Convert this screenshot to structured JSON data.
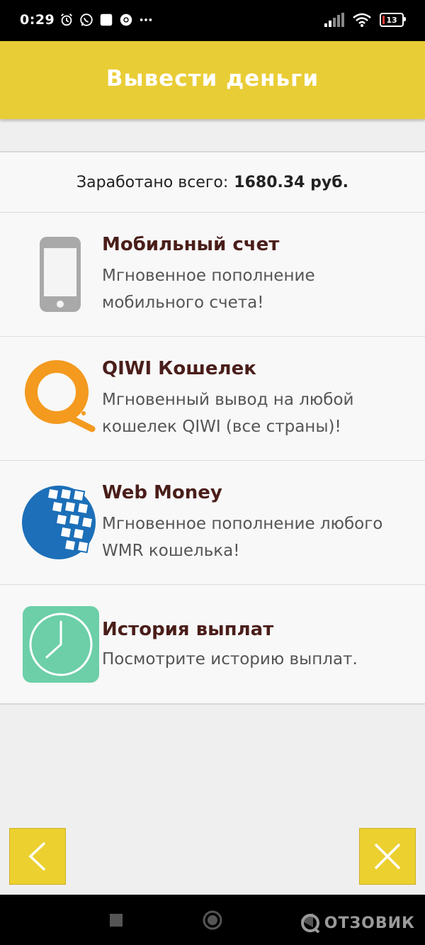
{
  "status_bar": {
    "time": "0:29",
    "battery": "13"
  },
  "header": {
    "title": "Вывести деньги"
  },
  "summary": {
    "label": "Заработано всего:",
    "amount": "1680.34 руб."
  },
  "methods": [
    {
      "title": "Мобильный счет",
      "desc": "Мгновенное пополнение мобильного счета!",
      "icon": "phone-icon"
    },
    {
      "title": "QIWI Кошелек",
      "desc": "Мгновенный вывод на любой кошелек QIWI (все страны)!",
      "icon": "qiwi-icon"
    },
    {
      "title": "Web Money",
      "desc": "Мгновенное пополнение любого WMR кошелька!",
      "icon": "webmoney-icon"
    },
    {
      "title": "История выплат",
      "desc": "Посмотрите историю выплат.",
      "icon": "clock-icon"
    }
  ],
  "watermark": "ОТЗОВИК",
  "colors": {
    "header_bg": "#e9cd36",
    "title_text": "#4a1e1a",
    "qiwi_orange": "#f39a1f",
    "webmoney_blue": "#1c6fb8",
    "history_green": "#6ccfa8"
  }
}
